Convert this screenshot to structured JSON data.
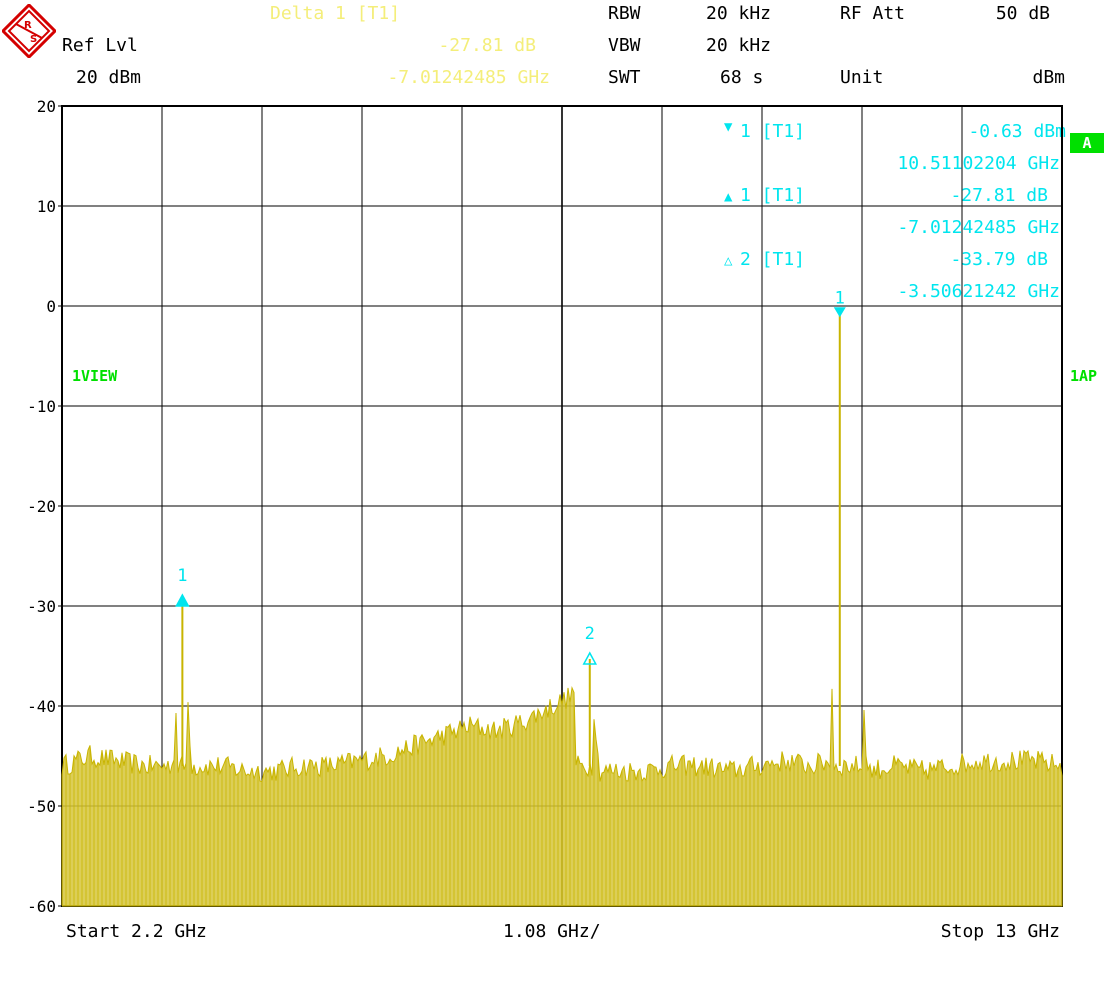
{
  "header": {
    "delta_title": "Delta 1 [T1]",
    "ref_lvl_label": "Ref Lvl",
    "ref_lvl_value": "20 dBm",
    "delta_level": "-27.81 dB",
    "delta_freq": "-7.01242485 GHz",
    "rbw_label": "RBW",
    "rbw_value": "20 kHz",
    "vbw_label": "VBW",
    "vbw_value": "20 kHz",
    "swt_label": "SWT",
    "swt_value": "68 s",
    "rfatt_label": "RF Att",
    "rfatt_value": "50 dB",
    "unit_label": "Unit",
    "unit_value": "dBm"
  },
  "side_labels": {
    "view": "1VIEW",
    "trace_mode": "1AP",
    "badge": "A"
  },
  "marker_table": [
    {
      "symbol": "▼",
      "label": "1 [T1]",
      "value": "-0.63 dBm",
      "freq": "10.51102204 GHz"
    },
    {
      "symbol": "▲",
      "label": "1 [T1]",
      "value": "-27.81 dB",
      "freq": "-7.01242485 GHz"
    },
    {
      "symbol": "△",
      "label": "2 [T1]",
      "value": "-33.79 dB",
      "freq": "-3.50621242 GHz"
    }
  ],
  "footer": {
    "start": "Start 2.2 GHz",
    "span_div": "1.08 GHz/",
    "stop": "Stop 13 GHz"
  },
  "colors": {
    "trace": "#c8b400",
    "trace_fill": "#d6c63a",
    "marker": "#00e5ee",
    "grid": "#000000",
    "label_green": "#00e000",
    "delta_text": "#f4ee7a"
  },
  "chart_data": {
    "type": "line",
    "xlabel": "",
    "ylabel": "",
    "xlim": [
      2.2,
      13.0
    ],
    "ylim": [
      -60,
      20
    ],
    "x_divisions": 10,
    "y_ticks": [
      20,
      10,
      0,
      -10,
      -20,
      -30,
      -40,
      -50,
      -60
    ],
    "y_tick_labels": [
      "20",
      "10",
      "0",
      "-10",
      "-20",
      "-30",
      "-40",
      "-50",
      "-60"
    ],
    "grid": true,
    "series": [
      {
        "x": [
          2.2,
          2.5,
          2.8,
          3.1,
          3.4,
          3.5,
          3.6,
          3.9,
          4.2,
          4.5,
          4.8,
          5.1,
          5.4,
          5.7,
          6.0,
          6.3,
          6.6,
          6.9,
          7.2,
          7.5,
          7.7,
          7.9,
          8.0,
          8.2,
          8.5,
          8.8,
          9.1,
          9.4,
          9.7,
          10.0,
          10.3,
          10.5,
          10.6,
          10.9,
          11.2,
          11.5,
          11.8,
          12.1,
          12.4,
          12.7,
          13.0
        ],
        "y": [
          -46,
          -45,
          -45.5,
          -46,
          -46,
          -29.5,
          -46,
          -46,
          -46.5,
          -46.5,
          -46,
          -46,
          -45.5,
          -45,
          -44,
          -43,
          -42,
          -42.5,
          -41.5,
          -40,
          -39,
          -35,
          -46.5,
          -46.5,
          -46.5,
          -46,
          -46,
          -46.5,
          -46,
          -45.5,
          -46,
          -45.5,
          -0.63,
          -46.5,
          -46,
          -46.5,
          -46,
          -45.5,
          -45.5,
          -45.5,
          -46
        ]
      }
    ],
    "markers": [
      {
        "label": "1",
        "x": 3.5,
        "y": -29.5,
        "shape": "filled-up"
      },
      {
        "label": "2",
        "x": 7.9,
        "y": -35.3,
        "shape": "open-up"
      },
      {
        "label": "1",
        "x": 10.6,
        "y": -0.63,
        "shape": "filled-down"
      }
    ]
  }
}
